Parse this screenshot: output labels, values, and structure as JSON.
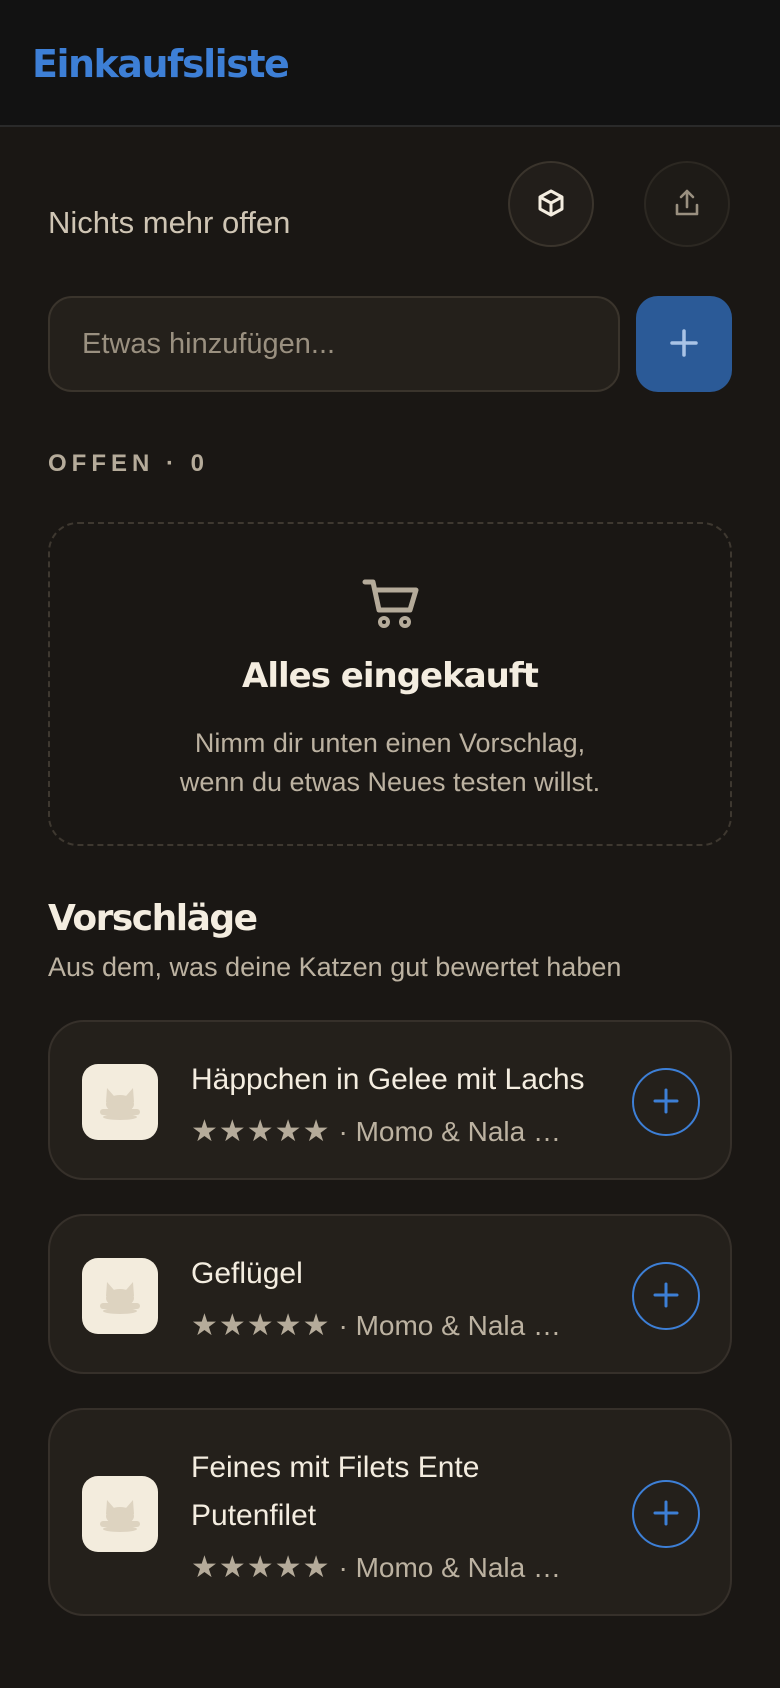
{
  "header": {
    "title": "Einkaufsliste"
  },
  "status": {
    "text": "Nichts mehr offen"
  },
  "actions": {
    "box_icon": "cube-icon",
    "share_icon": "share-icon"
  },
  "add_form": {
    "placeholder": "Etwas hinzufügen...",
    "add_icon": "plus-icon"
  },
  "open_section": {
    "label": "OFFEN · 0"
  },
  "empty_state": {
    "icon": "shopping-cart-icon",
    "title": "Alles eingekauft",
    "line1": "Nimm dir unten einen Vorschlag,",
    "line2": "wenn du etwas Neues testen willst."
  },
  "suggestions": {
    "title": "Vorschläge",
    "subtitle": "Aus dem, was deine Katzen gut bewertet haben",
    "items": [
      {
        "name": "Häppchen in Gelee mit Lachs",
        "stars": "★★★★★",
        "meta": "· Momo & Nala m...",
        "rating": 5,
        "icon": "cat-bowl-icon"
      },
      {
        "name": "Geflügel",
        "stars": "★★★★★",
        "meta": "· Momo & Nala m...",
        "rating": 5,
        "icon": "cat-bowl-icon"
      },
      {
        "name_line1": "Feines mit Filets Ente",
        "name_line2": "Putenfilet",
        "stars": "★★★★★",
        "meta": "· Momo & Nala m...",
        "rating": 5,
        "icon": "cat-bowl-icon"
      }
    ]
  },
  "colors": {
    "accent": "#3d7fd6",
    "background": "#1a1714",
    "card": "#24201b"
  }
}
